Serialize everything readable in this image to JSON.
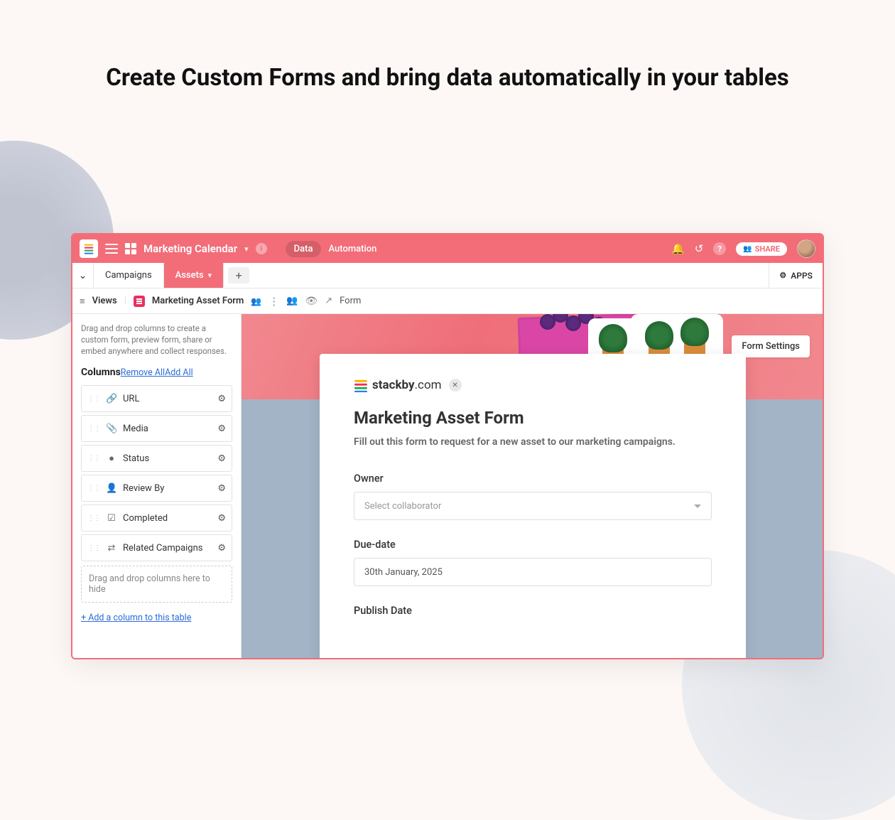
{
  "headline": "Create Custom Forms and bring data automatically in your tables",
  "topbar": {
    "workspace_title": "Marketing Calendar",
    "nav_data": "Data",
    "nav_automation": "Automation",
    "share_label": "SHARE"
  },
  "tabs": {
    "tab1": "Campaigns",
    "tab2": "Assets",
    "apps": "APPS"
  },
  "viewbar": {
    "views_label": "Views",
    "current_view": "Marketing Asset Form",
    "form_label": "Form"
  },
  "sidebar": {
    "hint": "Drag and drop columns to create a custom form, preview form, share or embed anywhere and collect responses.",
    "columns_title": "Columns",
    "remove_all": "Remove All",
    "add_all": "Add All",
    "columns": [
      {
        "label": "URL"
      },
      {
        "label": "Media"
      },
      {
        "label": "Status"
      },
      {
        "label": "Review By"
      },
      {
        "label": "Completed"
      },
      {
        "label": "Related Campaigns"
      }
    ],
    "drop_hint": "Drag and drop columns here to hide",
    "add_column": "+ Add a column to this table"
  },
  "canvas": {
    "form_settings": "Form Settings"
  },
  "form": {
    "brand": "stackby",
    "brand_suffix": ".com",
    "title": "Marketing Asset Form",
    "description": "Fill out this form to request for a new asset to our marketing campaigns.",
    "fields": {
      "owner_label": "Owner",
      "owner_placeholder": "Select collaborator",
      "due_label": "Due-date",
      "due_value": "30th January, 2025",
      "publish_label": "Publish Date"
    }
  }
}
